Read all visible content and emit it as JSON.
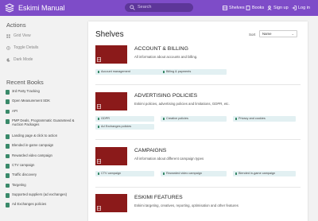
{
  "header": {
    "app_title": "Eskimi Manual",
    "search_placeholder": "Search",
    "nav": [
      {
        "label": "Shelves",
        "icon": "shelves-icon"
      },
      {
        "label": "Books",
        "icon": "book-icon"
      },
      {
        "label": "Sign up",
        "icon": "signup-icon"
      },
      {
        "label": "Log in",
        "icon": "login-icon"
      }
    ]
  },
  "sidebar": {
    "actions_heading": "Actions",
    "actions": [
      {
        "label": "Grid View",
        "icon": "grid-icon"
      },
      {
        "label": "Toggle Details",
        "icon": "details-icon"
      },
      {
        "label": "Dark Mode",
        "icon": "moon-icon"
      }
    ],
    "recent_heading": "Recent Books",
    "recent_books": [
      "3rd Party Tracking",
      "Open Measurement SDK",
      "API",
      "PMP Deals, Programmatic Guaranteed & Auction Packages",
      "Landing page & click to action",
      "Blended in-game campaign",
      "Rewarded video campaign",
      "CTV campaign",
      "Traffic discovery",
      "Targeting",
      "Supported suppliers (ad exchanges)",
      "Ad Exchanges policies"
    ]
  },
  "main": {
    "title": "Shelves",
    "sort_label": "Sort",
    "sort_value": "Name",
    "shelves": [
      {
        "name": "ACCOUNT & BILLING",
        "description": "All information about accounts and billing.",
        "books": [
          "Account management",
          "Billing & payments"
        ]
      },
      {
        "name": "ADVERTISING POLICIES",
        "description": "Eskimi policies, advertising policies and limitations, GDPR, etc.",
        "books": [
          "GDPR",
          "Creative policies",
          "Privacy and cookies",
          "Ad Exchanges policies"
        ]
      },
      {
        "name": "CAMPAIGNS",
        "description": "All information about different campaign types",
        "books": [
          "CTV campaign",
          "Rewarded video campaign",
          "Blended in-game campaign"
        ]
      },
      {
        "name": "ESKIMI FEATURES",
        "description": "Eskimi targeting, creatives, reporting, optimisation and other features",
        "books": []
      }
    ]
  },
  "colors": {
    "header": "#7e4cc8",
    "shelf_thumb": "#8b1a1a",
    "chip": "#e2f0f2",
    "book_icon": "#3a8a6a"
  }
}
